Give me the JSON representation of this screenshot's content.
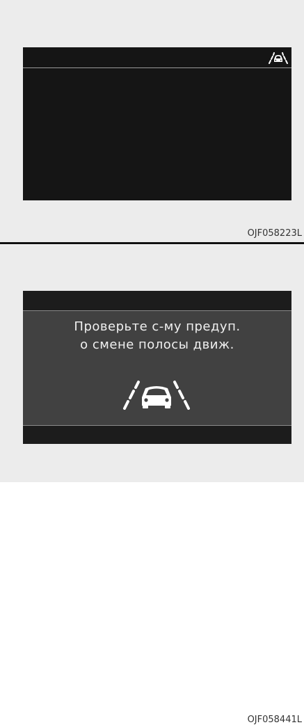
{
  "figure_top": {
    "code": "OJF058223L",
    "icon": "lane-change-assist-icon"
  },
  "figure_bottom": {
    "code": "OJF058441L",
    "message_line1": "Проверьте с-му предуп.",
    "message_line2": "о смене полосы движ.",
    "icon": "lane-change-assist-icon"
  }
}
